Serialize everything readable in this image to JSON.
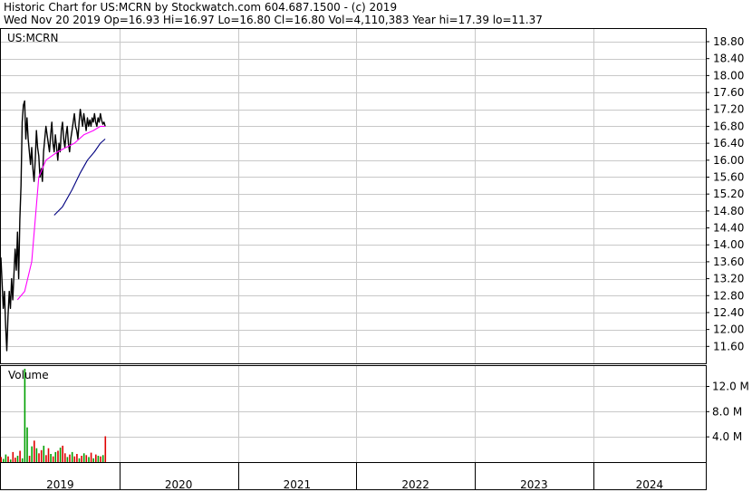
{
  "header": {
    "line1": "Historic Chart for US:MCRN by Stockwatch.com 604.687.1500 - (c) 2019",
    "line2": "Wed Nov 20 2019   Op=16.93  Hi=16.97  Lo=16.80  Cl=16.80  Vol=4,110,383   Year hi=17.39  lo=11.37"
  },
  "chart_data": [
    {
      "type": "line",
      "panel": "price",
      "symbol_label": "US:MCRN",
      "ylim": [
        11.2,
        19.1
      ],
      "y_ticks": [
        11.6,
        12.0,
        12.4,
        12.8,
        13.2,
        13.6,
        14.0,
        14.4,
        14.8,
        15.2,
        15.6,
        16.0,
        16.4,
        16.8,
        17.2,
        17.6,
        18.0,
        18.4,
        18.8
      ],
      "y_tick_labels": [
        "11.60",
        "12.00",
        "12.40",
        "12.80",
        "13.20",
        "13.60",
        "14.00",
        "14.40",
        "14.80",
        "15.20",
        "15.60",
        "16.00",
        "16.40",
        "16.80",
        "17.20",
        "17.60",
        "18.00",
        "18.40",
        "18.80"
      ],
      "x_range_years": [
        2019.0,
        2024.95
      ],
      "x_tick_labels": [
        "2019",
        "2020",
        "2021",
        "2022",
        "2023",
        "2024"
      ],
      "grid": true,
      "colors": {
        "price": "#000000",
        "ma_short": "#ff00ff",
        "ma_long": "#000080"
      },
      "series": [
        {
          "key": "price",
          "x": [
            2019.0,
            2019.01,
            2019.02,
            2019.03,
            2019.04,
            2019.05,
            2019.06,
            2019.07,
            2019.08,
            2019.09,
            2019.1,
            2019.11,
            2019.12,
            2019.13,
            2019.14,
            2019.15,
            2019.16,
            2019.17,
            2019.18,
            2019.19,
            2019.2,
            2019.21,
            2019.22,
            2019.23,
            2019.24,
            2019.25,
            2019.26,
            2019.27,
            2019.28,
            2019.29,
            2019.3,
            2019.31,
            2019.32,
            2019.33,
            2019.34,
            2019.35,
            2019.36,
            2019.37,
            2019.38,
            2019.39,
            2019.4,
            2019.41,
            2019.42,
            2019.43,
            2019.44,
            2019.45,
            2019.46,
            2019.47,
            2019.48,
            2019.49,
            2019.5,
            2019.51,
            2019.52,
            2019.53,
            2019.54,
            2019.55,
            2019.56,
            2019.57,
            2019.58,
            2019.59,
            2019.6,
            2019.61,
            2019.62,
            2019.63,
            2019.64,
            2019.65,
            2019.66,
            2019.67,
            2019.68,
            2019.69,
            2019.7,
            2019.71,
            2019.72,
            2019.73,
            2019.74,
            2019.75,
            2019.76,
            2019.77,
            2019.78,
            2019.79,
            2019.8,
            2019.81,
            2019.82,
            2019.83,
            2019.84,
            2019.85,
            2019.86,
            2019.87,
            2019.88
          ],
          "y": [
            13.7,
            13.1,
            12.5,
            12.9,
            12.1,
            11.5,
            12.3,
            12.9,
            12.5,
            13.2,
            12.7,
            13.3,
            13.9,
            13.4,
            14.3,
            13.2,
            14.6,
            15.4,
            16.9,
            17.3,
            17.4,
            16.5,
            17.0,
            16.5,
            16.2,
            15.9,
            16.3,
            15.8,
            15.5,
            16.0,
            16.7,
            16.3,
            16.1,
            15.6,
            15.8,
            15.5,
            16.2,
            16.5,
            16.8,
            16.6,
            16.4,
            16.2,
            16.6,
            16.9,
            16.4,
            16.2,
            16.6,
            16.3,
            16.0,
            16.4,
            16.2,
            16.7,
            16.9,
            16.5,
            16.3,
            16.6,
            16.8,
            16.4,
            16.2,
            16.5,
            16.7,
            16.9,
            17.1,
            16.8,
            16.7,
            16.5,
            16.9,
            17.2,
            17.0,
            16.8,
            17.1,
            16.9,
            16.7,
            17.0,
            16.8,
            16.95,
            16.8,
            17.0,
            16.9,
            17.1,
            16.9,
            16.8,
            17.0,
            16.9,
            17.1,
            16.95,
            16.85,
            16.9,
            16.8
          ]
        },
        {
          "key": "ma_short",
          "x": [
            2019.14,
            2019.2,
            2019.26,
            2019.32,
            2019.38,
            2019.43,
            2019.48,
            2019.55,
            2019.62,
            2019.7,
            2019.78,
            2019.84,
            2019.88
          ],
          "y": [
            12.7,
            12.9,
            13.6,
            15.6,
            16.0,
            16.1,
            16.2,
            16.3,
            16.4,
            16.6,
            16.7,
            16.8,
            16.8
          ]
        },
        {
          "key": "ma_long",
          "x": [
            2019.45,
            2019.52,
            2019.6,
            2019.67,
            2019.73,
            2019.79,
            2019.84,
            2019.88
          ],
          "y": [
            14.7,
            14.9,
            15.3,
            15.7,
            16.0,
            16.2,
            16.4,
            16.5
          ]
        }
      ]
    },
    {
      "type": "bar",
      "panel": "volume",
      "label": "Volume",
      "ylim": [
        0,
        14.8
      ],
      "y_ticks": [
        4.0,
        8.0,
        12.0
      ],
      "y_tick_labels": [
        "4.0 M",
        "8.0 M",
        "12.0 M"
      ],
      "grid": true,
      "colors": {
        "up": "#00a000",
        "down": "#e00000"
      },
      "x": [
        2019.0,
        2019.02,
        2019.04,
        2019.06,
        2019.08,
        2019.1,
        2019.12,
        2019.14,
        2019.16,
        2019.18,
        2019.2,
        2019.22,
        2019.24,
        2019.26,
        2019.28,
        2019.3,
        2019.32,
        2019.34,
        2019.36,
        2019.38,
        2019.4,
        2019.42,
        2019.44,
        2019.46,
        2019.48,
        2019.5,
        2019.52,
        2019.54,
        2019.56,
        2019.58,
        2019.6,
        2019.62,
        2019.64,
        2019.66,
        2019.68,
        2019.7,
        2019.72,
        2019.74,
        2019.76,
        2019.78,
        2019.8,
        2019.82,
        2019.84,
        2019.86,
        2019.88
      ],
      "values": [
        0.8,
        0.5,
        1.2,
        0.9,
        0.4,
        1.6,
        0.7,
        1.0,
        1.8,
        0.6,
        14.8,
        5.5,
        1.0,
        2.5,
        3.4,
        2.2,
        1.4,
        1.9,
        2.6,
        1.1,
        2.2,
        1.3,
        0.9,
        1.6,
        1.8,
        2.3,
        2.6,
        1.4,
        0.8,
        1.2,
        1.6,
        0.9,
        1.3,
        0.6,
        1.0,
        1.4,
        1.1,
        0.8,
        1.5,
        0.6,
        1.2,
        1.0,
        0.9,
        1.1,
        4.1
      ],
      "up": [
        false,
        true,
        true,
        false,
        true,
        false,
        false,
        true,
        false,
        true,
        true,
        true,
        false,
        true,
        false,
        true,
        false,
        false,
        true,
        false,
        false,
        true,
        false,
        true,
        false,
        true,
        false,
        false,
        true,
        false,
        true,
        false,
        false,
        true,
        false,
        true,
        false,
        true,
        false,
        true,
        false,
        true,
        false,
        true,
        false
      ]
    }
  ]
}
